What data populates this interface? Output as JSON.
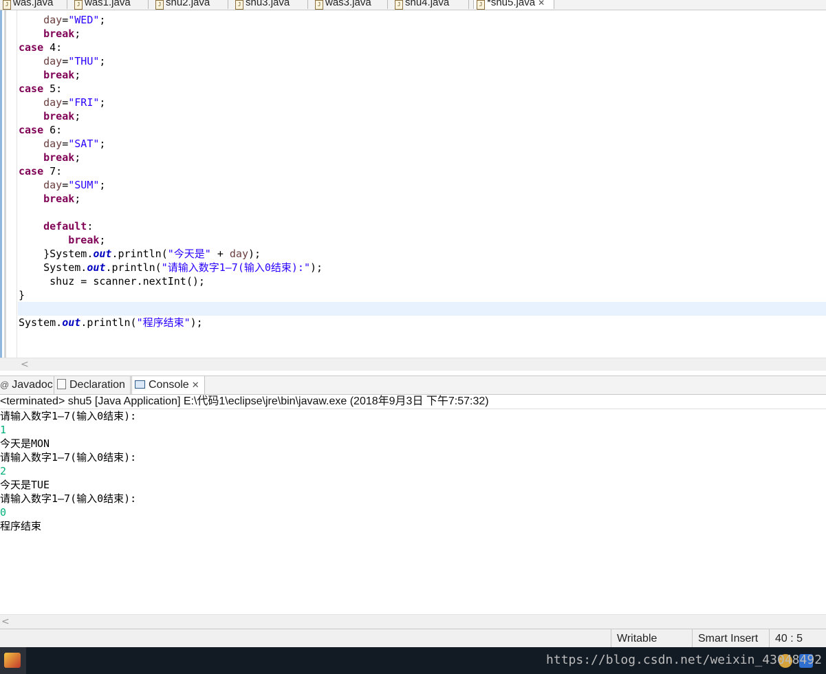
{
  "editor_tabs": [
    {
      "label": "was.java",
      "active": false
    },
    {
      "label": "was1.java",
      "active": false
    },
    {
      "label": "shu2.java",
      "active": false
    },
    {
      "label": "shu3.java",
      "active": false
    },
    {
      "label": "was3.java",
      "active": false
    },
    {
      "label": "shu4.java",
      "active": false
    },
    {
      "label": "*shu5.java",
      "active": true
    }
  ],
  "editor": {
    "lines": [
      "    day=\"WED\";",
      "    break;",
      "case 4:",
      "    day=\"THU\";",
      "    break;",
      "case 5:",
      "    day=\"FRI\";",
      "    break;",
      "case 6:",
      "    day=\"SAT\";",
      "    break;",
      "case 7:",
      "    day=\"SUM\";",
      "    break;",
      "",
      "    default:",
      "        break;",
      "    }System.out.println(\"今天是\" + day);",
      "    System.out.println(\"请输入数字1—7(输入0结束):\");",
      "     shuz = scanner.nextInt();",
      "}",
      "",
      "System.out.println(\"程序结束\");"
    ]
  },
  "views": {
    "tabs": [
      {
        "label": "Javadoc",
        "icon": "at-icon",
        "active": false
      },
      {
        "label": "Declaration",
        "icon": "declaration-icon",
        "active": false
      },
      {
        "label": "Console",
        "icon": "console-icon",
        "active": true
      }
    ]
  },
  "console": {
    "header": "<terminated> shu5 [Java Application] E:\\代码1\\eclipse\\jre\\bin\\javaw.exe (2018年9月3日 下午7:57:32)",
    "lines": [
      {
        "text": "请输入数字1—7(输入0结束):",
        "input": false
      },
      {
        "text": "1",
        "input": true
      },
      {
        "text": "今天是MON",
        "input": false
      },
      {
        "text": "请输入数字1—7(输入0结束):",
        "input": false
      },
      {
        "text": "2",
        "input": true
      },
      {
        "text": "今天是TUE",
        "input": false
      },
      {
        "text": "请输入数字1—7(输入0结束):",
        "input": false
      },
      {
        "text": "0",
        "input": true
      },
      {
        "text": "程序结束",
        "input": false
      }
    ]
  },
  "status": {
    "writable": "Writable",
    "insert_mode": "Smart Insert",
    "position": "40 : 5"
  },
  "taskbar": {
    "watermark": "https://blog.csdn.net/weixin_43048492"
  },
  "colors": {
    "keyword": "#7f0055",
    "string": "#2a00ff",
    "field": "#0000c0",
    "variable": "#6a3e3e",
    "console_input": "#00b07a",
    "current_line": "#e8f2fe"
  }
}
